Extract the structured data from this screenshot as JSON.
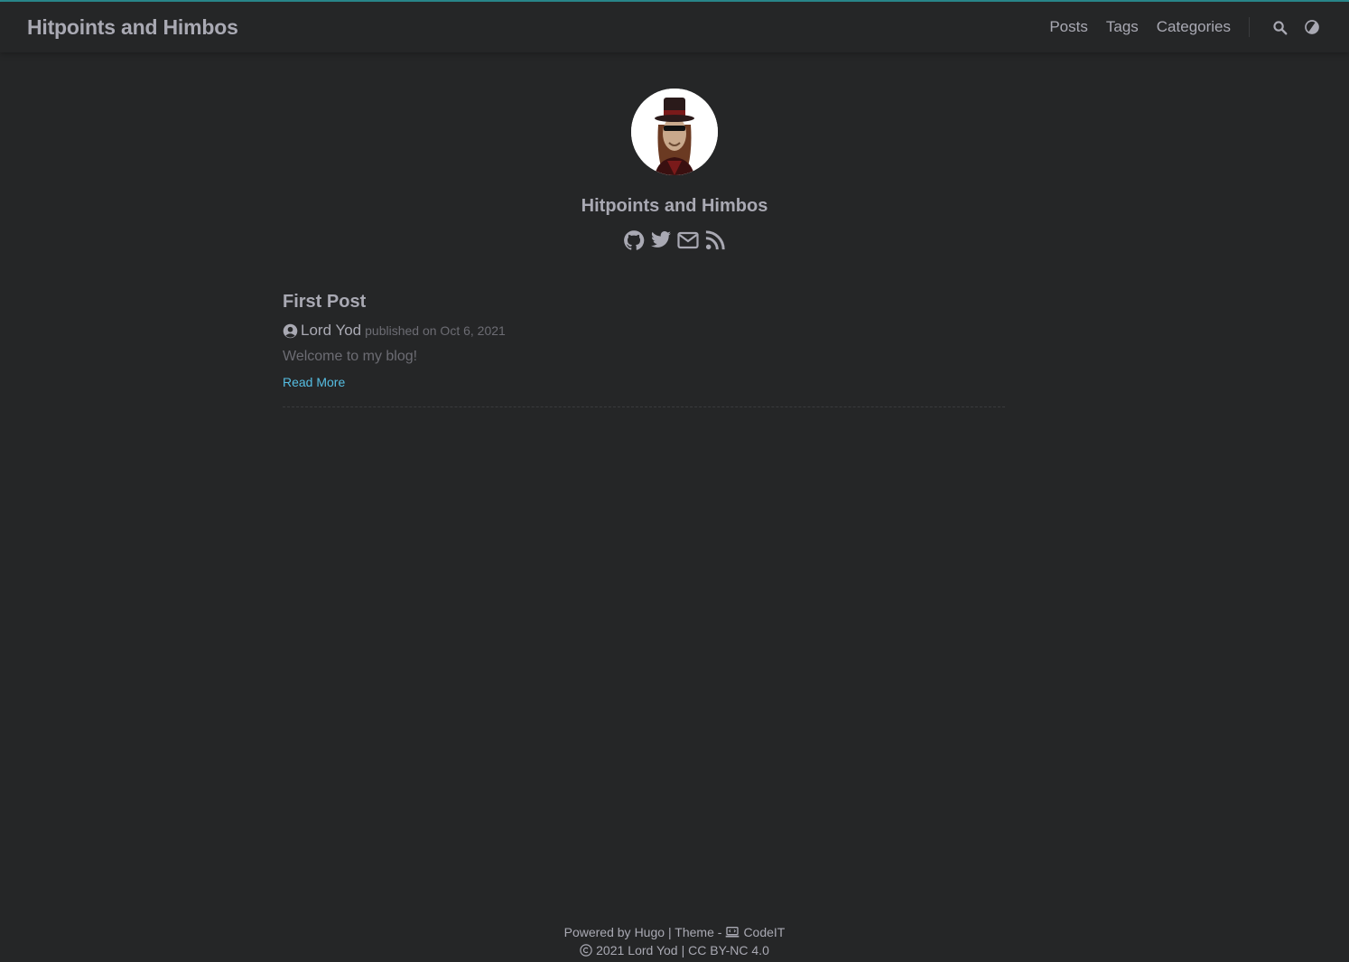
{
  "site": {
    "title": "Hitpoints and Himbos",
    "accent_color": "#2a8a8f"
  },
  "nav": {
    "items": [
      {
        "label": "Posts"
      },
      {
        "label": "Tags"
      },
      {
        "label": "Categories"
      }
    ],
    "search_icon": "search-icon",
    "theme_icon": "theme-switch-icon"
  },
  "profile": {
    "avatar_alt": "avatar",
    "title": "Hitpoints and Himbos",
    "social_icons": [
      "github-icon",
      "twitter-icon",
      "email-icon",
      "rss-icon"
    ]
  },
  "posts": [
    {
      "title": "First Post",
      "author": "Lord Yod",
      "published": "published on Oct 6, 2021",
      "summary": "Welcome to my blog!",
      "read_more": "Read More"
    }
  ],
  "footer": {
    "powered_by": "Powered by",
    "hugo": "Hugo",
    "theme_sep": "| Theme -",
    "theme_name": "CodeIT",
    "copyright_year": "2021",
    "copyright_owner": "Lord Yod",
    "license": "| CC BY-NC 4.0"
  },
  "colors": {
    "background": "#252627",
    "text": "#a9a9b3",
    "muted": "#6c6c73",
    "link": "#55bde2"
  }
}
